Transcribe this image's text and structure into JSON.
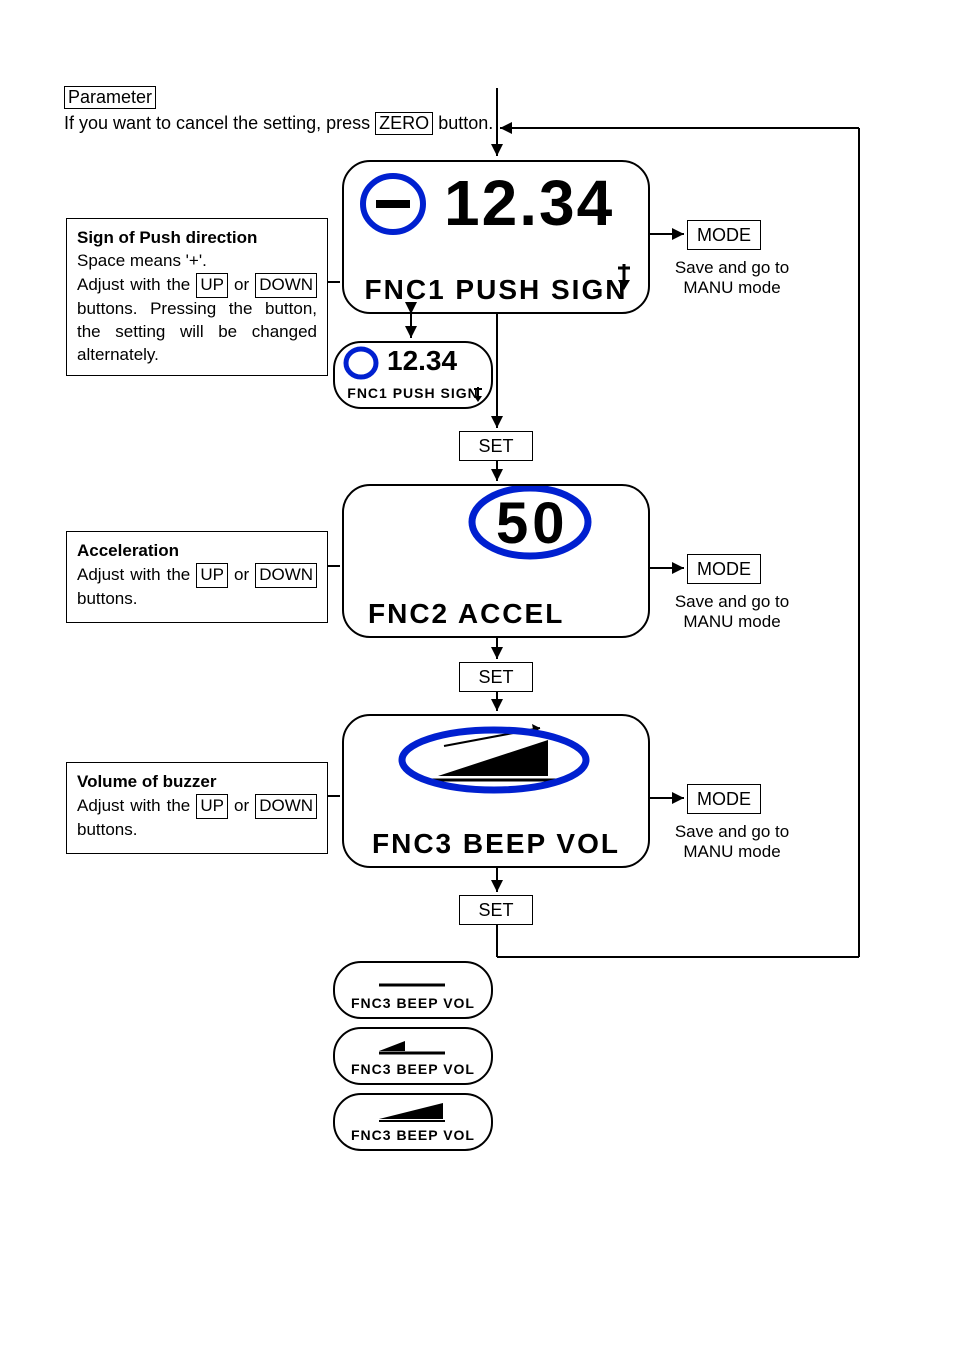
{
  "header": {
    "parameter": "Parameter",
    "intro_pre": "If you want to cancel the setting, press ",
    "intro_btn": "ZERO",
    "intro_post": " button."
  },
  "info": {
    "push": {
      "title": "Sign of Push direction",
      "l1": "Space means '+'.",
      "l2a": "Adjust with the ",
      "l2b": "UP",
      "l2c": " or ",
      "l2d": "DOWN",
      "l2e": " buttons. Pressing the button, the setting will be changed alternately."
    },
    "accel": {
      "title": "Acceleration",
      "l1a": "Adjust with the ",
      "l1b": "UP",
      "l1c": " or ",
      "l1d": "DOWN",
      "l1e": " buttons."
    },
    "vol": {
      "title": "Volume of buzzer",
      "l1a": "Adjust with the ",
      "l1b": "UP",
      "l1c": " or ",
      "l1d": "DOWN",
      "l1e": " buttons."
    }
  },
  "buttons": {
    "set": "SET",
    "mode": "MODE"
  },
  "side_caption": "Save and go to MANU mode",
  "lcd": {
    "push_big_value": "12.34",
    "push_big_label": "FNC1 PUSH SIGN",
    "push_small_value": "12.34",
    "push_small_label": "FNC1 PUSH SIGN",
    "accel_value": "50",
    "accel_label": "FNC2 ACCEL",
    "vol_label": "FNC3 BEEP VOL",
    "vol_small_label": "FNC3 BEEP VOL"
  }
}
